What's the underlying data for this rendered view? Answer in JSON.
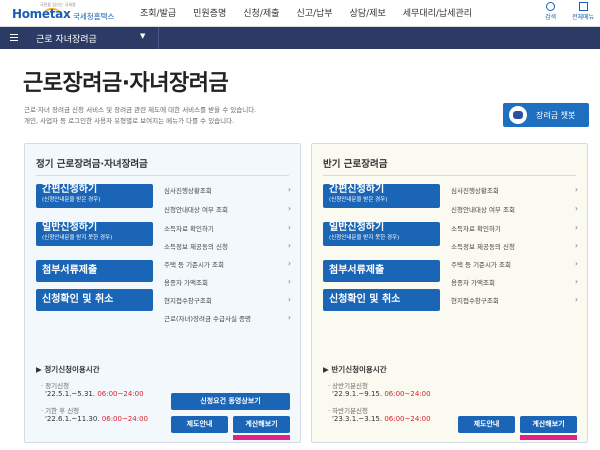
{
  "header": {
    "logo_tagline": "국민을 섬기는 국세청",
    "logo_main": "Hometax",
    "logo_sub": "국세청홈택스",
    "menu": [
      "조회/발급",
      "민원증명",
      "신청/제출",
      "신고/납부",
      "상담/제보",
      "세무대리/납세관리"
    ],
    "util_search": "검색",
    "util_allmenu": "전체메뉴"
  },
  "nav": {
    "breadcrumb": "근로 자녀장려금"
  },
  "page": {
    "title": "근로장려금·자녀장려금",
    "desc_line1": "근로·자녀 장려금 신청 서비스 및 장려금 관련 제도에 대한 서비스를 받을 수 있습니다.",
    "desc_line2": "개인, 사업자 등 로그인한 사용자 유형별로 보여지는 메뉴가 다를 수 있습니다.",
    "chatbot_label": "장려금 챗봇"
  },
  "left_panel": {
    "title": "정기 근로장려금·자녀장려금",
    "buttons": [
      {
        "main": "간편신청하기",
        "sub": "(신청안내문을 받은 경우)"
      },
      {
        "main": "일반신청하기",
        "sub": "(신청안내문을 받지 못한 경우)"
      },
      {
        "main": "첨부서류제출",
        "sub": ""
      },
      {
        "main": "신청확인 및 취소",
        "sub": ""
      }
    ],
    "services": [
      "심사진행상황조회",
      "신청안내대상 여부 조회",
      "소득자료 확인하기",
      "소득정보 제공동의 신청",
      "주택 등 기준시가 조회",
      "용종자 가액조회",
      "현지접수창구조회",
      "근로(자녀)장려금 수급사실 증명"
    ],
    "hours_title": "정기신청이용시간",
    "periods": [
      {
        "label": "· 정기신청",
        "dates": "'22.5.1.~5.31.",
        "time": "06:00~24:00"
      },
      {
        "label": "· 기한 후 신청",
        "dates": "'22.6.1.~11.30.",
        "time": "06:00~24:00"
      }
    ],
    "btn_video": "신청요건 동영상보기",
    "btn_guide": "제도안내",
    "btn_calc": "계산해보기"
  },
  "right_panel": {
    "title": "반기 근로장려금",
    "buttons": [
      {
        "main": "간편신청하기",
        "sub": "(신청안내문을 받은 경우)"
      },
      {
        "main": "일반신청하기",
        "sub": "(신청안내문을 받지 못한 경우)"
      },
      {
        "main": "첨부서류제출",
        "sub": ""
      },
      {
        "main": "신청확인 및 취소",
        "sub": ""
      }
    ],
    "services": [
      "심사진행상황조회",
      "신청안내대상 여부 조회",
      "소득자료 확인하기",
      "소득정보 제공동의 신청",
      "주택 등 기준시가 조회",
      "용종자 가액조회",
      "현지접수창구조회"
    ],
    "hours_title": "반기신청이용시간",
    "periods": [
      {
        "label": "· 상반기분신청",
        "dates": "'22.9.1.~9.15.",
        "time": "06:00~24:00"
      },
      {
        "label": "· 하반기분신청",
        "dates": "'23.3.1.~3.15.",
        "time": "06:00~24:00"
      }
    ],
    "btn_guide": "제도안내",
    "btn_calc": "계산해보기"
  },
  "colors": {
    "navy": "#2c3a66",
    "button_blue": "#1a65b6",
    "time_red": "#d9232d",
    "highlight": "#e3208a"
  }
}
